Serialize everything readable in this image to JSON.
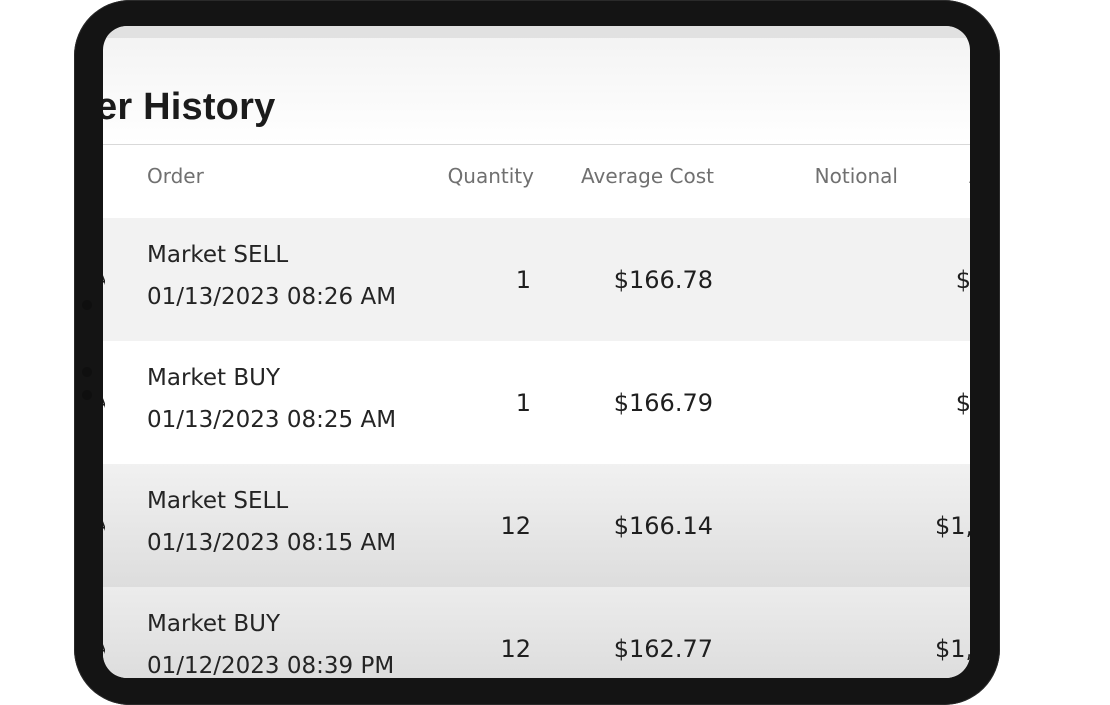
{
  "screen": {
    "title": "er History"
  },
  "table": {
    "headers": {
      "order": "Order",
      "quantity": "Quantity",
      "average_cost": "Average Cost",
      "notional": "Notional",
      "partial_next": "A"
    },
    "rows": [
      {
        "order_type": "Market SELL",
        "timestamp": "01/13/2023 08:26 AM",
        "quantity": "1",
        "average_cost": "$166.78",
        "notional_partial": "$"
      },
      {
        "order_type": "Market BUY",
        "timestamp": "01/13/2023 08:25 AM",
        "quantity": "1",
        "average_cost": "$166.79",
        "notional_partial": "$"
      },
      {
        "order_type": "Market SELL",
        "timestamp": "01/13/2023 08:15 AM",
        "quantity": "12",
        "average_cost": "$166.14",
        "notional_partial": "$1,"
      },
      {
        "order_type": "Market BUY",
        "timestamp": "01/12/2023 08:39 PM",
        "quantity": "12",
        "average_cost": "$162.77",
        "notional_partial": "$1,"
      }
    ],
    "left_partial_marks": [
      "A",
      "A",
      "A",
      "A"
    ]
  }
}
